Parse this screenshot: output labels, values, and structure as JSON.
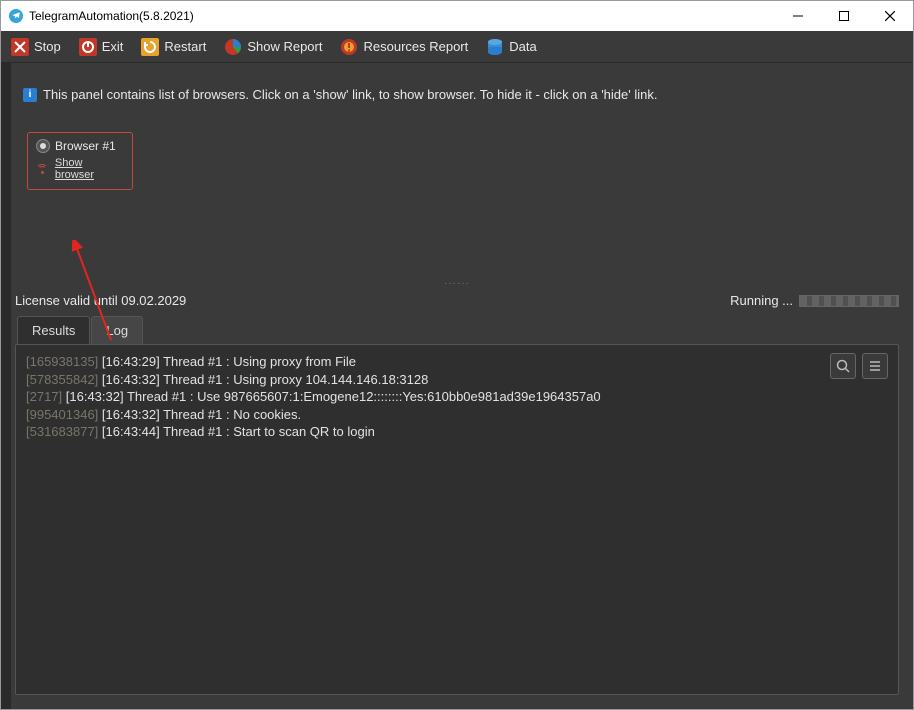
{
  "window": {
    "title": "TelegramAutomation(5.8.2021)"
  },
  "toolbar": {
    "stop": "Stop",
    "exit": "Exit",
    "restart": "Restart",
    "show_report": "Show Report",
    "resources_report": "Resources Report",
    "data": "Data"
  },
  "panel": {
    "info_text": "This panel contains list of browsers. Click on a 'show' link, to show browser. To hide it - click on a 'hide' link.",
    "browser": {
      "title": "Browser #1",
      "show_link": "Show browser"
    }
  },
  "status": {
    "license": "License valid until 09.02.2029",
    "running": "Running ..."
  },
  "tabs": {
    "results": "Results",
    "log": "Log"
  },
  "log": {
    "lines": [
      {
        "id": "[165938135]",
        "rest": " [16:43:29] Thread #1 : Using proxy from File"
      },
      {
        "id": "[578355842]",
        "rest": " [16:43:32] Thread #1 : Using proxy 104.144.146.18:3128"
      },
      {
        "id": "[2717]",
        "rest": " [16:43:32] Thread #1 : Use 987665607:1:Emogene12::::::::Yes:610bb0e981ad39e1964357a0"
      },
      {
        "id": "[995401346]",
        "rest": " [16:43:32] Thread #1 : No cookies."
      },
      {
        "id": "[531683877]",
        "rest": " [16:43:44] Thread #1 : Start to scan QR to login"
      }
    ]
  }
}
